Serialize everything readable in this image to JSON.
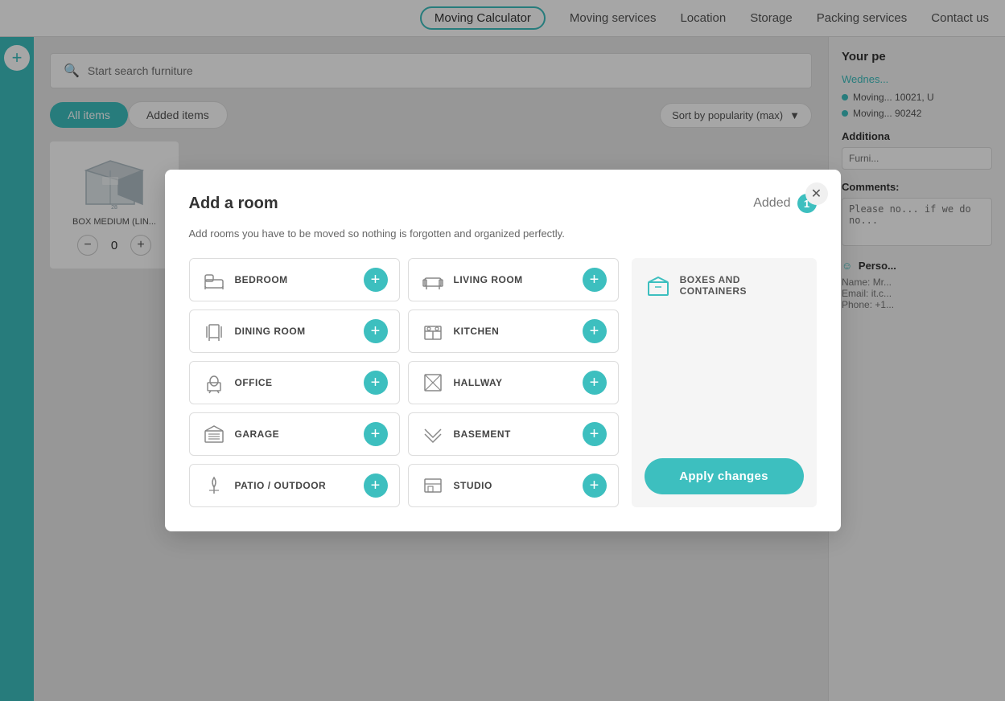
{
  "nav": {
    "calculator_label": "Moving Calculator",
    "moving_services_label": "Moving services",
    "location_label": "Location",
    "storage_label": "Storage",
    "packing_services_label": "Packing services",
    "contact_label": "Contact us"
  },
  "search": {
    "placeholder": "Start search furniture"
  },
  "tabs": {
    "all_items": "All items",
    "added_items": "Added items"
  },
  "sort": {
    "label": "Sort by popularity (max)"
  },
  "item": {
    "label": "BOX MEDIUM (LIN...",
    "qty": "0"
  },
  "right_sidebar": {
    "title": "Your pe",
    "date": "Wednes...",
    "move1": "Moving... 10021, U",
    "move2": "Moving... 90242",
    "additional_title": "Additiona",
    "furniture_placeholder": "Furni...",
    "comments_title": "Comments:",
    "comments_placeholder": "Please no... if we do no...",
    "personal_title": "Perso...",
    "name_label": "Name:",
    "name_value": "Mr...",
    "email_label": "Email:",
    "email_value": "it.c...",
    "phone_label": "Phone:",
    "phone_value": "+1..."
  },
  "modal": {
    "title": "Add a room",
    "added_label": "Added",
    "added_count": "1",
    "description": "Add rooms you have to be moved so nothing is forgotten and organized perfectly.",
    "rooms": [
      {
        "id": "bedroom",
        "name": "BEDROOM",
        "icon": "bed"
      },
      {
        "id": "living_room",
        "name": "LIVING ROOM",
        "icon": "sofa"
      },
      {
        "id": "dining_room",
        "name": "DINING ROOM",
        "icon": "dining"
      },
      {
        "id": "kitchen",
        "name": "KITCHEN",
        "icon": "kitchen"
      },
      {
        "id": "office",
        "name": "OFFICE",
        "icon": "office"
      },
      {
        "id": "hallway",
        "name": "HALLWAY",
        "icon": "hallway"
      },
      {
        "id": "garage",
        "name": "GARAGE",
        "icon": "garage"
      },
      {
        "id": "basement",
        "name": "BASEMENT",
        "icon": "basement"
      },
      {
        "id": "patio",
        "name": "PATIO / OUTDOOR",
        "icon": "patio"
      },
      {
        "id": "studio",
        "name": "STUDIO",
        "icon": "studio"
      }
    ],
    "boxes_label": "BOXES AND CONTAINERS",
    "apply_label": "Apply changes"
  }
}
